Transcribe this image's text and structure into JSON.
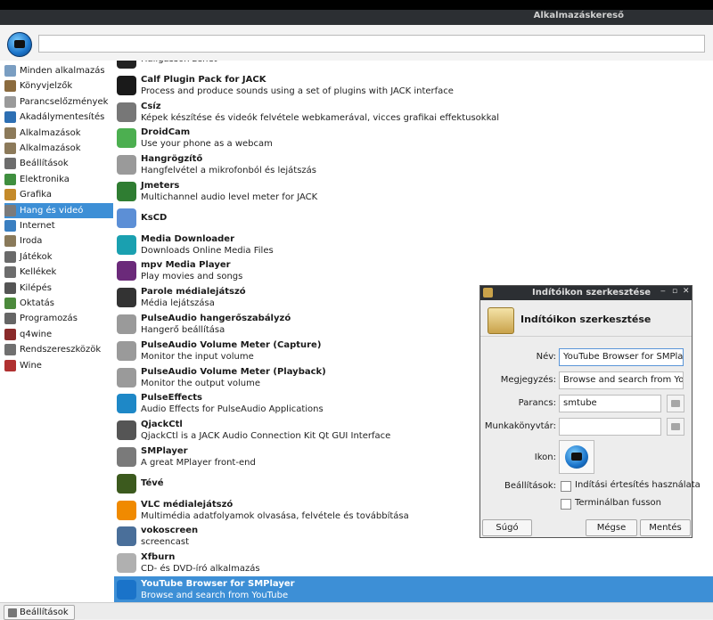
{
  "window": {
    "title": "Alkalmazáskereső"
  },
  "search": {
    "placeholder": ""
  },
  "categories": [
    {
      "label": "Minden alkalmazás",
      "icon": "all-apps-icon",
      "color": "#7a9ec2"
    },
    {
      "label": "Könyvjelzők",
      "icon": "bookmarks-icon",
      "color": "#8b6b3e"
    },
    {
      "label": "Parancselőzmények",
      "icon": "history-icon",
      "color": "#9a9a9a"
    },
    {
      "label": "Akadálymentesítés",
      "icon": "accessibility-icon",
      "color": "#2d6fb3"
    },
    {
      "label": "Alkalmazások",
      "icon": "applications-icon",
      "color": "#8c7a5a"
    },
    {
      "label": "Alkalmazások",
      "icon": "applications-icon",
      "color": "#8c7a5a"
    },
    {
      "label": "Beállítások",
      "icon": "settings-icon",
      "color": "#6d6d6d"
    },
    {
      "label": "Elektronika",
      "icon": "electronics-icon",
      "color": "#3f8f3f"
    },
    {
      "label": "Grafika",
      "icon": "graphics-icon",
      "color": "#c48a2a"
    },
    {
      "label": "Hang és videó",
      "icon": "multimedia-icon",
      "color": "#7b7b7b"
    },
    {
      "label": "Internet",
      "icon": "internet-icon",
      "color": "#3a7fc1"
    },
    {
      "label": "Iroda",
      "icon": "office-icon",
      "color": "#8a7a5a"
    },
    {
      "label": "Játékok",
      "icon": "games-icon",
      "color": "#6a6a6a"
    },
    {
      "label": "Kellékek",
      "icon": "accessories-icon",
      "color": "#6d6d6d"
    },
    {
      "label": "Kilépés",
      "icon": "logout-icon",
      "color": "#555555"
    },
    {
      "label": "Oktatás",
      "icon": "education-icon",
      "color": "#4c8a3c"
    },
    {
      "label": "Programozás",
      "icon": "programming-icon",
      "color": "#666666"
    },
    {
      "label": "q4wine",
      "icon": "wine-glass-icon",
      "color": "#8a2a2a"
    },
    {
      "label": "Rendszereszközök",
      "icon": "system-tools-icon",
      "color": "#707070"
    },
    {
      "label": "Wine",
      "icon": "wine-icon",
      "color": "#b03030"
    }
  ],
  "selected_category_index": 9,
  "apps": [
    {
      "name": "",
      "desc": "Hallgasson zenét",
      "icon": "music-player-icon",
      "color": "#222222"
    },
    {
      "name": "Calf Plugin Pack for JACK",
      "desc": "Process and produce sounds using a set of plugins with JACK interface",
      "icon": "calf-icon",
      "color": "#1a1a1a"
    },
    {
      "name": "Csíz",
      "desc": "Képek készítése és videók felvétele webkamerával, vicces grafikai effektusokkal",
      "icon": "webcam-icon",
      "color": "#777777"
    },
    {
      "name": "DroidCam",
      "desc": "Use your phone as a webcam",
      "icon": "droidcam-icon",
      "color": "#4caf50"
    },
    {
      "name": "Hangrögzítő",
      "desc": "Hangfelvétel a mikrofonból és lejátszás",
      "icon": "microphone-record-icon",
      "color": "#9a9a9a"
    },
    {
      "name": "Jmeters",
      "desc": "Multichannel audio level meter for JACK",
      "icon": "jmeters-icon",
      "color": "#2f7d32"
    },
    {
      "name": "KsCD",
      "desc": "",
      "icon": "cd-player-icon",
      "color": "#5c8fd6"
    },
    {
      "name": "Media Downloader",
      "desc": "Downloads Online Media Files",
      "icon": "download-icon",
      "color": "#1aa0b0"
    },
    {
      "name": "mpv Media Player",
      "desc": "Play movies and songs",
      "icon": "mpv-icon",
      "color": "#6b2a7a"
    },
    {
      "name": "Parole médialejátszó",
      "desc": "Média lejátszása",
      "icon": "parole-icon",
      "color": "#333333"
    },
    {
      "name": "PulseAudio hangerőszabályzó",
      "desc": "Hangerő beállítása",
      "icon": "microphone-icon",
      "color": "#9a9a9a"
    },
    {
      "name": "PulseAudio Volume Meter (Capture)",
      "desc": "Monitor the input volume",
      "icon": "microphone-icon",
      "color": "#9a9a9a"
    },
    {
      "name": "PulseAudio Volume Meter (Playback)",
      "desc": "Monitor the output volume",
      "icon": "microphone-icon",
      "color": "#9a9a9a"
    },
    {
      "name": "PulseEffects",
      "desc": "Audio Effects for PulseAudio Applications",
      "icon": "pulseeffects-icon",
      "color": "#1e88c7"
    },
    {
      "name": "QjackCtl",
      "desc": "QjackCtl is a JACK Audio Connection Kit Qt GUI Interface",
      "icon": "jack-plug-icon",
      "color": "#555555"
    },
    {
      "name": "SMPlayer",
      "desc": "A great MPlayer front-end",
      "icon": "smplayer-icon",
      "color": "#7a7a7a"
    },
    {
      "name": "Tévé",
      "desc": "",
      "icon": "tv-icon",
      "color": "#3c5a1e"
    },
    {
      "name": "VLC médialejátszó",
      "desc": "Multimédia adatfolyamok olvasása, felvétele és továbbítása",
      "icon": "vlc-cone-icon",
      "color": "#f08a00"
    },
    {
      "name": "vokoscreen",
      "desc": "screencast",
      "icon": "screencast-icon",
      "color": "#4a6f9a"
    },
    {
      "name": "Xfburn",
      "desc": "CD- és DVD-író alkalmazás",
      "icon": "disc-burn-icon",
      "color": "#b0b0b0"
    },
    {
      "name": "YouTube Browser for SMPlayer",
      "desc": "Browse and search from YouTube",
      "icon": "smtube-icon",
      "color": "#1a73c9"
    }
  ],
  "selected_app_index": 20,
  "dialog": {
    "title": "Indítóikon szerkesztése",
    "heading": "Indítóikon szerkesztése",
    "name_label": "Név:",
    "name_value": "YouTube Browser for SMPlayer",
    "comment_label": "Megjegyzés:",
    "comment_value": "Browse and search from YouTu",
    "command_label": "Parancs:",
    "command_value": "smtube",
    "workdir_label": "Munkakönyvtár:",
    "workdir_value": "",
    "icon_label": "Ikon:",
    "options_label": "Beállítások:",
    "option_notify": "Indítási értesítés használata",
    "option_terminal": "Terminálban fusson",
    "help_button": "Súgó",
    "cancel_button": "Mégse",
    "save_button": "Mentés"
  },
  "bottom": {
    "settings_button": "Beállítások"
  },
  "colors": {
    "selection": "#3d8fd6",
    "titlebar": "#2c2f33"
  }
}
